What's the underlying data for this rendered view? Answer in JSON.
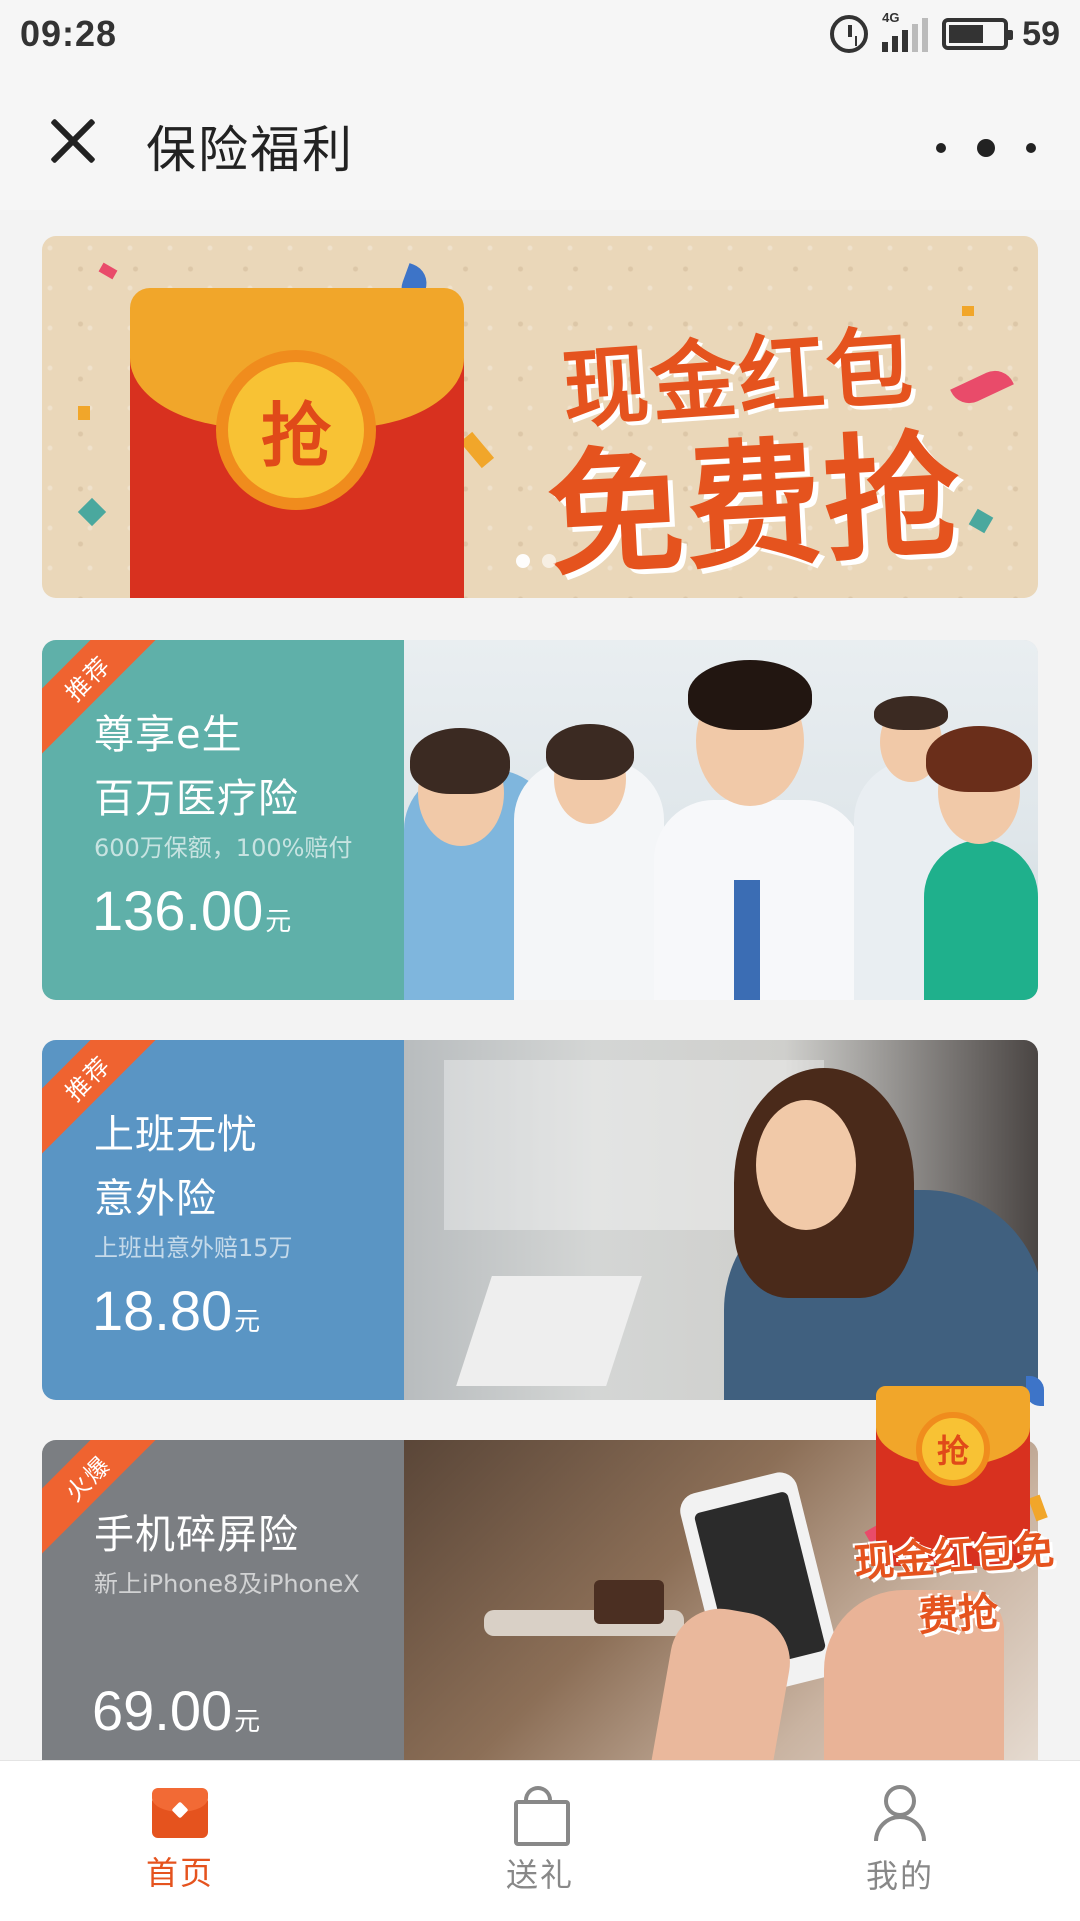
{
  "status_bar": {
    "time": "09:28",
    "network": "4G",
    "battery": "59"
  },
  "header": {
    "title": "保险福利"
  },
  "banner": {
    "line1": "现金红包",
    "line2": "免费抢",
    "coin_text": "抢",
    "active_dot": 1,
    "dot_count": 2
  },
  "products": [
    {
      "tag": "推荐",
      "title_line1": "尊享e生",
      "title_line2": "百万医疗险",
      "subtitle": "600万保额，100%赔付",
      "price": "136.00",
      "unit": "元",
      "color": "#5fb0a9"
    },
    {
      "tag": "推荐",
      "title_line1": "上班无忧",
      "title_line2": "意外险",
      "subtitle": "上班出意外赔15万",
      "price": "18.80",
      "unit": "元",
      "color": "#5a95c4"
    },
    {
      "tag": "火爆",
      "title_line1": "手机碎屏险",
      "subtitle": "新上iPhone8及iPhoneX",
      "price": "69.00",
      "unit": "元",
      "color": "#7b7e82"
    }
  ],
  "floating_packet": {
    "coin_text": "抢",
    "line1": "现金",
    "line2": "红包免费抢"
  },
  "tabs": [
    {
      "label": "首页",
      "icon": "home-icon",
      "active": true
    },
    {
      "label": "送礼",
      "icon": "gift-icon",
      "active": false
    },
    {
      "label": "我的",
      "icon": "user-icon",
      "active": false
    }
  ],
  "colors": {
    "accent": "#e5531e",
    "ribbon": "#ef6330"
  }
}
